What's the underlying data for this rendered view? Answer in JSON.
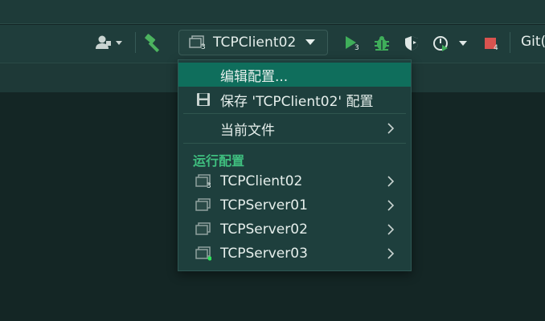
{
  "toolbar": {
    "config_name": "TCPClient02",
    "config_badge": "3",
    "run_badge": "3",
    "stop_badge": "4",
    "git_label": "Git("
  },
  "menu": {
    "items": [
      {
        "label": "编辑配置...",
        "selected": true
      },
      {
        "label": "保存 'TCPClient02' 配置",
        "icon": "save-icon"
      },
      {
        "label": "当前文件",
        "submenu": true
      }
    ],
    "section_title": "运行配置",
    "configs": [
      {
        "label": "TCPClient02",
        "badge": "3"
      },
      {
        "label": "TCPServer01"
      },
      {
        "label": "TCPServer02"
      },
      {
        "label": "TCPServer03",
        "running": true
      }
    ]
  },
  "colors": {
    "accent": "#0f6e5c",
    "run_green": "#3fae5a",
    "stop_red": "#d9534f",
    "section_green": "#3fbf7f"
  }
}
